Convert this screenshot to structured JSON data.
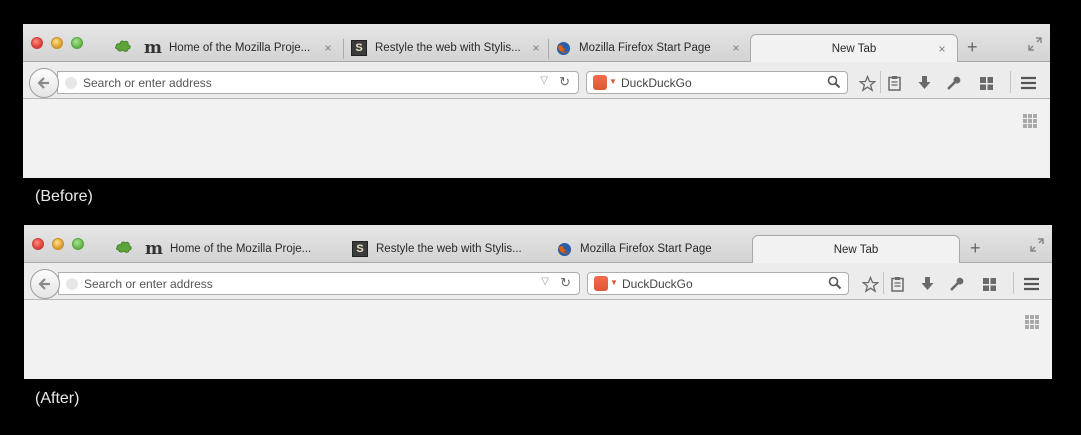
{
  "panels": [
    {
      "caption": "(Before)",
      "tabs": [
        {
          "label": "Home of the Mozilla Proje...",
          "favicon": "mozilla-m-icon",
          "closable": true
        },
        {
          "label": "Restyle the web with Stylis...",
          "favicon": "stylish-s-icon",
          "closable": true
        },
        {
          "label": "Mozilla Firefox Start Page",
          "favicon": "firefox-icon",
          "closable": true
        },
        {
          "label": "New Tab",
          "favicon": "",
          "closable": true,
          "active": true
        }
      ],
      "url_placeholder": "Search or enter address",
      "search_placeholder": "DuckDuckGo"
    },
    {
      "caption": "(After)",
      "tabs": [
        {
          "label": "Home of the Mozilla Proje...",
          "favicon": "mozilla-m-icon",
          "closable": false
        },
        {
          "label": "Restyle the web with Stylis...",
          "favicon": "stylish-s-icon",
          "closable": false
        },
        {
          "label": "Mozilla Firefox Start Page",
          "favicon": "firefox-icon",
          "closable": false
        },
        {
          "label": "New Tab",
          "favicon": "",
          "closable": false,
          "active": true
        }
      ],
      "url_placeholder": "Search or enter address",
      "search_placeholder": "DuckDuckGo"
    }
  ],
  "icons": {
    "pinned_tab": "puzzle-icon",
    "new_tab": "+",
    "close_tab": "×",
    "back": "arrow-left-icon",
    "reload": "reload-icon",
    "search": "magnifier-icon",
    "bookmark": "star-icon",
    "reading_list": "clipboard-icon",
    "downloads": "download-icon",
    "tools": "wrench-icon",
    "panel": "panel-icon",
    "menu": "hamburger-icon",
    "tiles": "grid-icon",
    "fullscreen": "fullscreen-icon"
  },
  "colors": {
    "background": "#000000",
    "chrome": "#ececec",
    "caption": "#eaeaea",
    "search_engine": "#de5833"
  }
}
